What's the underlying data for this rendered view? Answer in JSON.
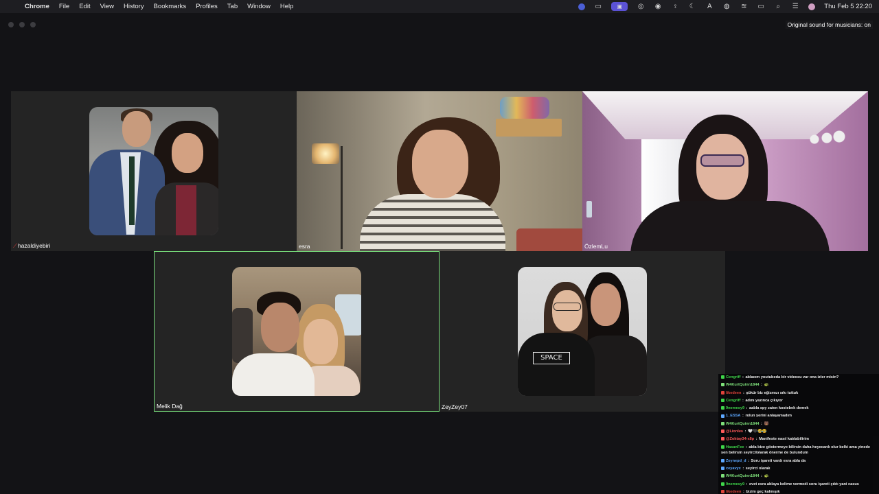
{
  "menubar": {
    "app": "Chrome",
    "items": [
      "File",
      "Edit",
      "View",
      "History",
      "Bookmarks",
      "Profiles",
      "Tab",
      "Window",
      "Help"
    ],
    "clock": "Thu Feb 5  22:20"
  },
  "window": {
    "original_sound_label": "Original sound for musicians: on"
  },
  "participants": [
    {
      "name": "hazaldiyebiri",
      "muted": true
    },
    {
      "name": "esra"
    },
    {
      "name": "ÖzlemLu"
    },
    {
      "name": "Melik Dağ",
      "active_speaker": true
    },
    {
      "name": "ZeyZey07"
    }
  ],
  "zeyzey_shirt_text": "SPACE",
  "chat": {
    "messages": [
      {
        "user": "Cengriff",
        "text": "ablacım youtubeda bir videosu var ona izler misin?",
        "color": "#3fd64a"
      },
      {
        "user": "W4KurtQuinn1844",
        "text": "🐢",
        "color": "#7ee07a"
      },
      {
        "user": "likedeen",
        "text": "şükür biz eğizmızı sıkı tuttuk",
        "color": "#e0433a"
      },
      {
        "user": "Cengriff",
        "text": "adını yazınca çıkıyor",
        "color": "#3fd64a"
      },
      {
        "user": "9nemesy9",
        "text": "aabla spy zaten kostebek demek",
        "color": "#3fd64a"
      },
      {
        "user": "1_ESSA",
        "text": "rolun yerini anlayamadım",
        "color": "#5ea8ff"
      },
      {
        "user": "W4KurtQuinn1844",
        "text": "🐻",
        "color": "#7ee07a"
      },
      {
        "user": "@Lionles",
        "text": "🤍🖤😂😂",
        "color": "#ff5a5a"
      },
      {
        "user": "@Zoktay34-x8p",
        "text": "Manifeste nasıl katılabilirim",
        "color": "#ff5a5a"
      },
      {
        "user": "HasanFee",
        "text": "abla bize göstermeye bilirsin daha heyecanlı olur belki ama yinede sen belirsin seyircilolarak önerme de bulundum",
        "color": "#3fd64a",
        "wrap": true
      },
      {
        "user": "Zeynepd_d",
        "text": "Soru işareti vardı esra abla da",
        "color": "#5ea8ff"
      },
      {
        "user": "ceyavyx",
        "text": "seyirci olarak",
        "color": "#5ea8ff"
      },
      {
        "user": "W4KurtQuinn1844",
        "text": "🐢",
        "color": "#7ee07a"
      },
      {
        "user": "9nemesy9",
        "text": "evet esra ablaya kelime vermedi soru işareti çıktı yani casus",
        "color": "#3fd64a"
      },
      {
        "user": "likedeen",
        "text": "bizim geç kalmışık",
        "color": "#e0433a"
      }
    ]
  },
  "colors": {
    "active_speaker_border": "#79e07c",
    "tile_bg": "#242424",
    "window_bg": "#131316",
    "muted_mic": "#e23b3b"
  }
}
